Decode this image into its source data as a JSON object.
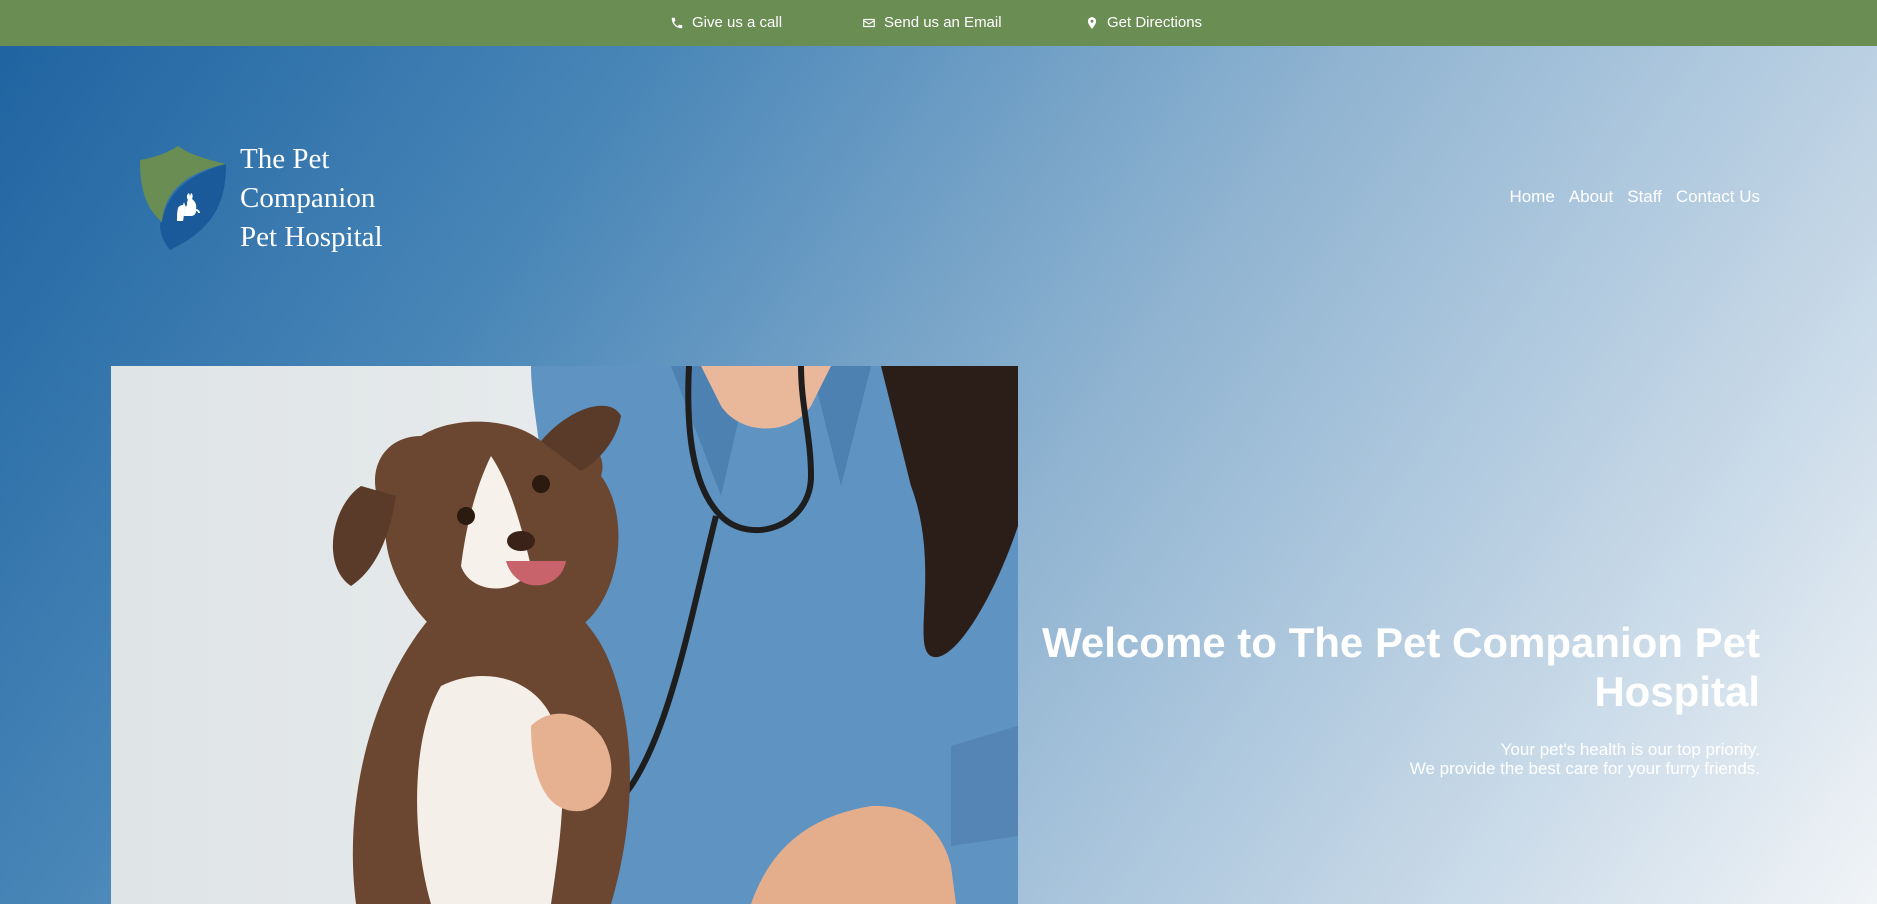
{
  "topbar": {
    "call": {
      "label": "Give us a call",
      "icon": "phone-icon"
    },
    "email": {
      "label": "Send us an Email",
      "icon": "envelope-icon"
    },
    "directions": {
      "label": "Get Directions",
      "icon": "map-pin-icon"
    }
  },
  "brand": {
    "name_lines": [
      "The Pet",
      "Companion",
      "Pet Hospital"
    ],
    "shield_green": "#6a8d54",
    "shield_blue": "#1a5a9a"
  },
  "nav": {
    "items": [
      "Home",
      "About",
      "Staff",
      "Contact Us"
    ]
  },
  "hero": {
    "title": "Welcome to The Pet Companion Pet Hospital",
    "subtitle_lines": [
      "Your pet's health is our top priority.",
      "We provide the best care for your furry friends."
    ],
    "image_alt": "Puppy with veterinarian"
  },
  "colors": {
    "topbar": "#6a8d54",
    "gradient_start": "#1d62a0",
    "gradient_end": "#f1f4f7"
  }
}
